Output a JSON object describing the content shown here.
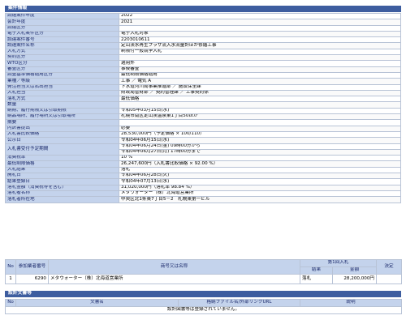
{
  "case_info": {
    "title": "案件情報",
    "rows": [
      {
        "label": "調達案件年度",
        "value": "2022"
      },
      {
        "label": "会計年度",
        "value": "2021"
      },
      {
        "label": "調達区分",
        "value": ""
      },
      {
        "label": "電子入札案件区分",
        "value": "電子入札対象"
      },
      {
        "label": "調達案件番号",
        "value": "2203010611"
      },
      {
        "label": "調達案件名称",
        "value": "定山渓水再生プラザ流入水流量計ほか修繕工事"
      },
      {
        "label": "入札方式",
        "value": "制限付一般競争入札"
      },
      {
        "label": "契約区分",
        "value": ""
      },
      {
        "label": "WTO区分",
        "value": "適用外"
      },
      {
        "label": "審査区分",
        "value": "事後審査"
      },
      {
        "label": "調査基準価格適用区分",
        "value": "最低制限価格適用"
      },
      {
        "label": "業種／等級",
        "value": "工事 ／ 電気 A"
      },
      {
        "label": "発注担当又は払出担当",
        "value": "下水道河川局事業推進部 ／ 施設保全課"
      },
      {
        "label": "入札担当",
        "value": "財政局管財部 ／ 契約管理課 ／ 工事契約係"
      },
      {
        "label": "落札方式",
        "value": "最低価格"
      },
      {
        "label": "数量",
        "value": ""
      },
      {
        "label": "納期、履行期限又は引取期限",
        "value": "令和05年03月15日(水)"
      },
      {
        "label": "納品場所、履行場所又は引取場所",
        "value": "札幌市南区定山渓温泉東1丁目50ほか"
      },
      {
        "label": "摘要",
        "value": ""
      },
      {
        "label": "内訳書提出",
        "value": "必要"
      },
      {
        "label": "入札書比較価格",
        "value": "28,530,000円（予定価格 × 100/110）"
      },
      {
        "label": "公示日",
        "value": "令和04年06月15日(水)"
      },
      {
        "label": "入札書受付予定期間",
        "value": "令和04年06月24日(金) 09時00分から"
      },
      {
        "label": "",
        "value": "令和04年06月27日(月) 17時00分まで"
      },
      {
        "label": "消費税率",
        "value": "10 %"
      },
      {
        "label": "最低制限価格",
        "value": "26,247,600円（入札書比較価格 × 92.00 %）"
      },
      {
        "label": "入札結果",
        "value": "落札"
      },
      {
        "label": "開札日",
        "value": "令和04年06月28日(火)"
      },
      {
        "label": "結果登録日",
        "value": "令和04年07月13日(水)"
      },
      {
        "label": "落札金額（消費税等を含む）",
        "value": "31,020,000円（落札率 98.84 %）"
      },
      {
        "label": "落札者名称",
        "value": "メタウォーター（株）北海道営業所"
      },
      {
        "label": "落札者所在地",
        "value": "中央区北1条東7丁目5－2　札幌東第一ビル"
      }
    ]
  },
  "bid_results": {
    "headers": {
      "no": "No",
      "bidder_no": "参加業者番号",
      "name": "商号又は名称",
      "round1": "第1回入札",
      "result": "結果",
      "amount": "金額",
      "decision": "決定"
    },
    "rows": [
      {
        "no": "1",
        "bidder_no": "6290",
        "name": "メタウォーター（株）北海道営業所",
        "result": "落札",
        "amount": "28,200,000円",
        "decision": ""
      }
    ]
  },
  "design_docs": {
    "title": "設計文書等",
    "headers": {
      "no": "No",
      "name": "文書名",
      "file_link": "格納ファイル名/外部リンクURL",
      "description": "説明"
    },
    "empty_message": "設計図書等は登録されていません。"
  }
}
